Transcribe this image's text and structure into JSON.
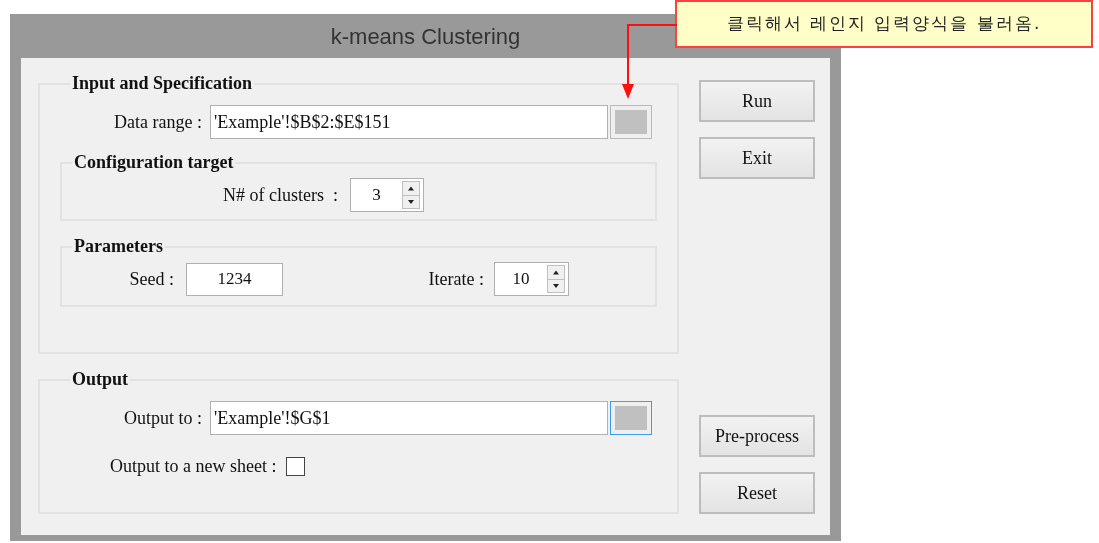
{
  "window": {
    "title": "k-means Clustering"
  },
  "callout": {
    "text": "클릭해서 레인지 입력양식을 불러옴."
  },
  "input_group": {
    "title": "Input and Specification",
    "data_range": {
      "label": "Data range :",
      "value": "'Example'!$B$2:$E$151",
      "button_focused": false
    },
    "configuration": {
      "title": "Configuration target",
      "clusters": {
        "label": "N# of clusters  :",
        "value": "3"
      }
    },
    "parameters": {
      "title": "Parameters",
      "seed": {
        "label": "Seed :",
        "value": "1234"
      },
      "iterate": {
        "label": "Iterate :",
        "value": "10"
      }
    }
  },
  "output_group": {
    "title": "Output",
    "output_to": {
      "label": "Output to :",
      "value": "'Example'!$G$1",
      "button_focused": true
    },
    "new_sheet": {
      "label": "Output to a new sheet :",
      "checked": false
    }
  },
  "buttons_top": [
    "Run",
    "Exit"
  ],
  "buttons_bottom": [
    "Pre-process",
    "Reset"
  ]
}
